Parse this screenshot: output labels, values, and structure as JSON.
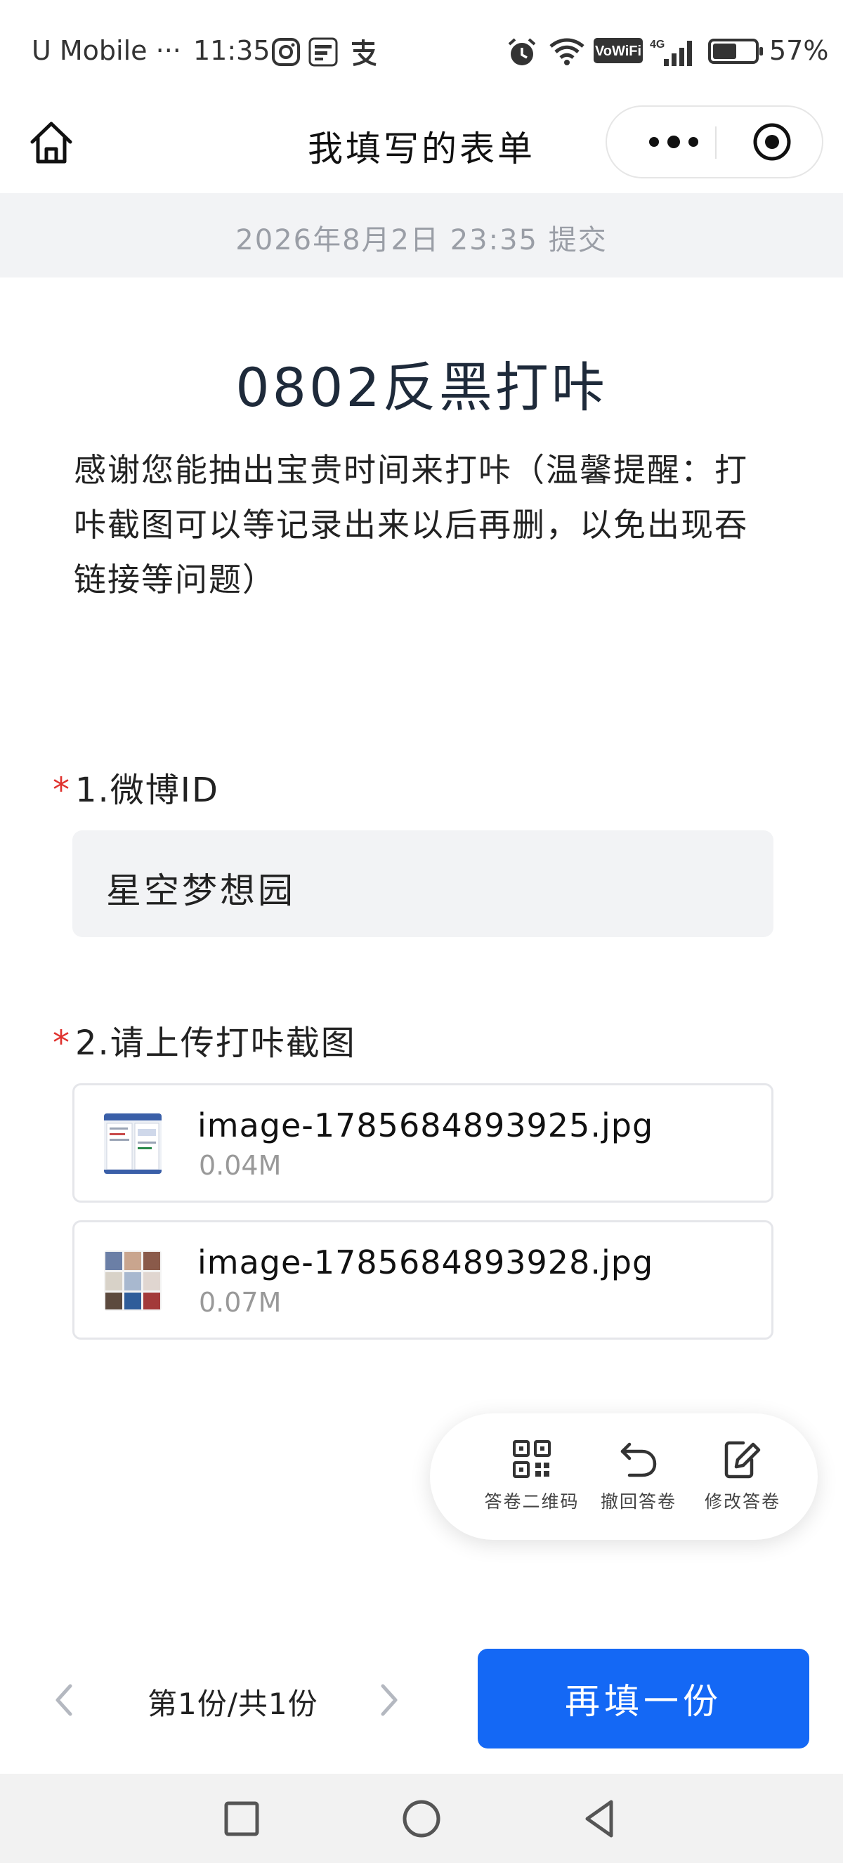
{
  "status_bar": {
    "carrier": "U Mobile ···",
    "time": "11:35",
    "battery_percent": "57%",
    "battery_level": 0.57,
    "icons": [
      "instagram-icon",
      "touch-n-go-icon",
      "alipay-icon",
      "alarm-icon",
      "wifi-icon",
      "vowifi-icon",
      "4g-signal-icon",
      "battery-icon"
    ]
  },
  "navbar": {
    "title": "我填写的表单",
    "home_icon": "home-icon",
    "more_icon": "more-icon",
    "target_icon": "target-icon"
  },
  "submit_time": "2026年8月2日 23:35 提交",
  "form": {
    "title": "0802反黑打咔",
    "description": "感谢您能抽出宝贵时间来打咔（温馨提醒：打咔截图可以等记录出来以后再删，以免出现吞链接等问题）",
    "questions": [
      {
        "required_mark": "*",
        "label": "1.微博ID",
        "answer": "星空梦想园"
      },
      {
        "required_mark": "*",
        "label": "2.请上传打咔截图",
        "files": [
          {
            "name": "image-1785684893925.jpg",
            "size": "0.04M"
          },
          {
            "name": "image-1785684893928.jpg",
            "size": "0.07M"
          }
        ]
      }
    ]
  },
  "actions": [
    {
      "label": "答卷二维码",
      "icon": "qr-code-icon"
    },
    {
      "label": "撤回答卷",
      "icon": "undo-icon"
    },
    {
      "label": "修改答卷",
      "icon": "edit-icon"
    }
  ],
  "pager": {
    "text": "第1份/共1份",
    "prev_icon": "chevron-left-icon",
    "next_icon": "chevron-right-icon"
  },
  "refill_button": "再填一份",
  "colors": {
    "accent": "#1468f5",
    "required": "#e0332f",
    "muted_band": "#f2f3f5",
    "muted_text": "#9a9ea6"
  }
}
